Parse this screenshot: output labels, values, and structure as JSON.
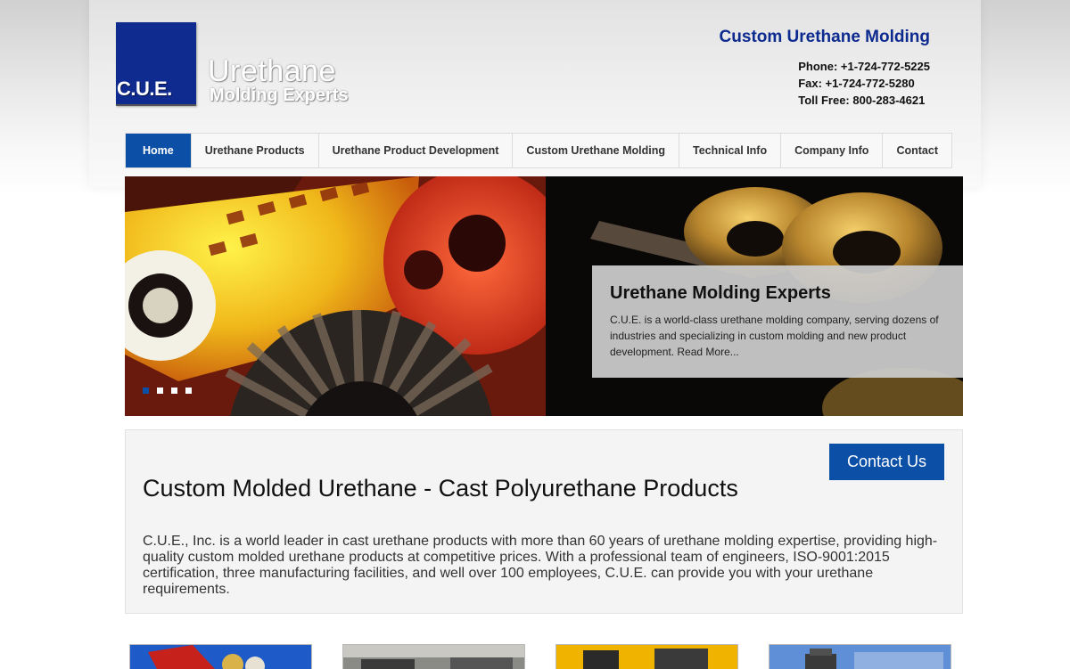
{
  "logo": {
    "badge": "C.U.E.",
    "word1": "Urethane",
    "word2": "Molding Experts"
  },
  "header": {
    "title": "Custom Urethane Molding",
    "phone": "Phone: +1-724-772-5225",
    "fax": "Fax: +1-724-772-5280",
    "tollfree": "Toll Free: 800-283-4621"
  },
  "nav": {
    "items": [
      {
        "label": "Home",
        "active": true
      },
      {
        "label": "Urethane Products"
      },
      {
        "label": "Urethane Product Development"
      },
      {
        "label": "Custom Urethane Molding"
      },
      {
        "label": "Technical Info"
      },
      {
        "label": "Company Info"
      },
      {
        "label": "Contact"
      }
    ]
  },
  "hero": {
    "title": "Urethane Molding Experts",
    "body": "C.U.E. is a world-class urethane molding company, serving dozens of industries and specializing in custom molding and new product development.  Read More...",
    "slides": 4,
    "active_slide": 1
  },
  "intro": {
    "contact_button": "Contact Us",
    "heading": "Custom Molded Urethane - Cast Polyurethane Products",
    "body": "C.U.E., Inc. is a world leader in cast urethane products with more than 60 years of urethane molding expertise, providing high-quality custom molded urethane products at competitive prices.  With a professional team of engineers, ISO-9001:2015 certification, three manufacturing facilities, and well over 100 employees, C.U.E. can provide you with your urethane requirements."
  },
  "colors": {
    "brand_blue": "#0c4fa6",
    "logo_blue": "#102b8f",
    "header_title": "#0d2a8f"
  }
}
